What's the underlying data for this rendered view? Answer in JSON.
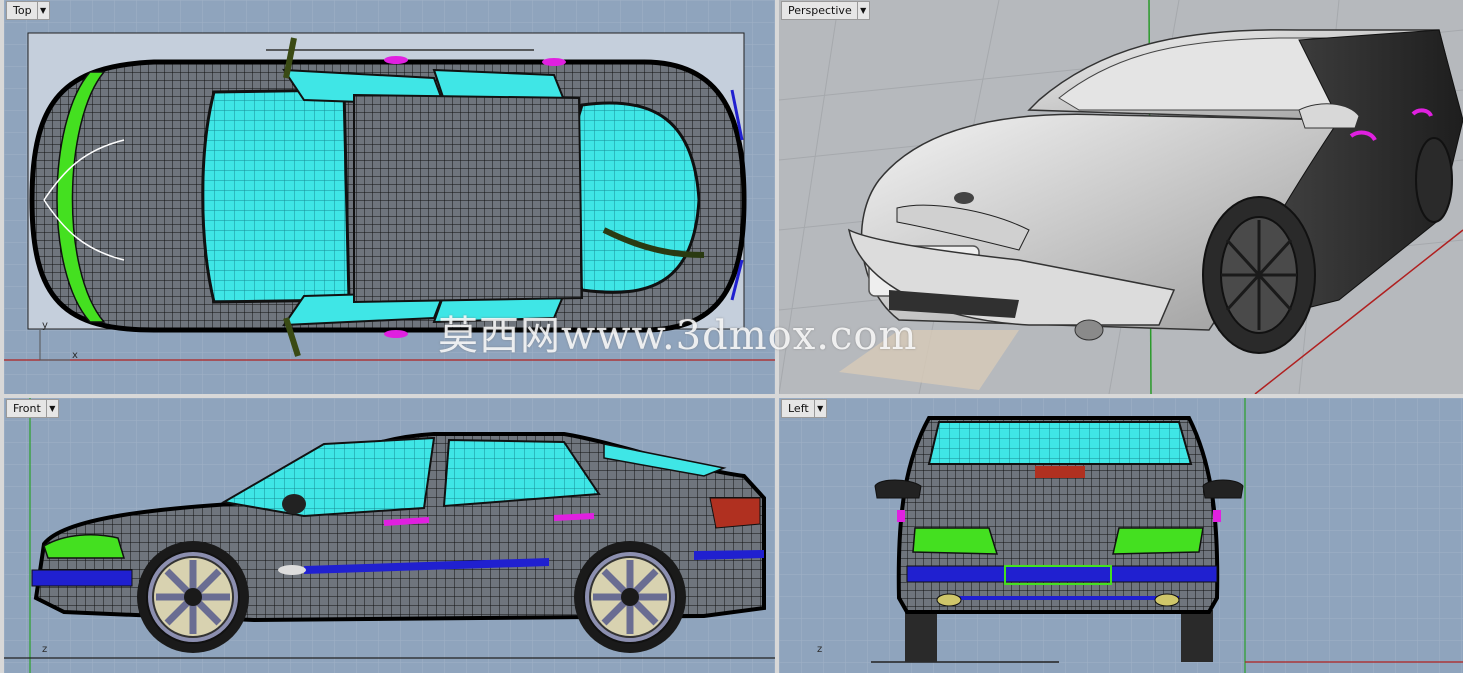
{
  "viewports": {
    "top": {
      "label": "Top",
      "axis_y": "y",
      "axis_x": "x"
    },
    "perspective": {
      "label": "Perspective"
    },
    "front": {
      "label": "Front",
      "axis_z": "z"
    },
    "left": {
      "label": "Left",
      "axis_z": "z"
    }
  },
  "watermark": "莫西网www.3dmox.com",
  "colors": {
    "viewport_bg": "#8fa4bd",
    "perspective_bg": "#b6b9bd",
    "grid": "#a4b5c9",
    "grid_major": "#7d8ea6",
    "x_axis": "#b02020",
    "y_axis": "#2aa02a",
    "glass": "#2ee8e8",
    "lights": "#39e020",
    "trim": "#2020d0",
    "accent": "#e020e0"
  }
}
